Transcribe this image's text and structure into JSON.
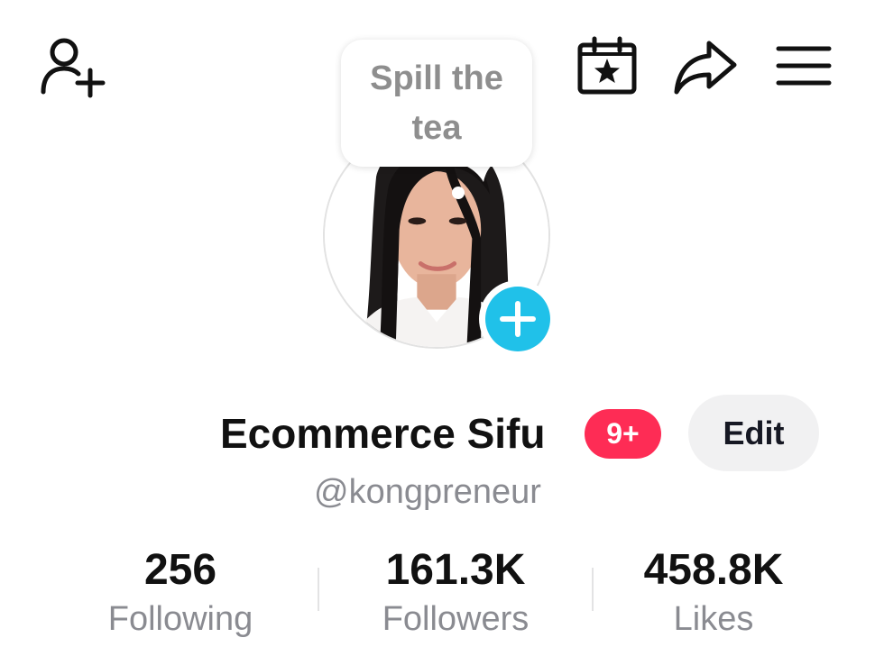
{
  "header": {
    "add_friend_icon": "person-plus-icon",
    "calendar_icon": "calendar-star-icon",
    "share_icon": "share-arrow-icon",
    "menu_icon": "hamburger-menu-icon"
  },
  "note_bubble": {
    "text": "Spill the tea"
  },
  "profile": {
    "display_name": "Ecommerce Sifu",
    "notification_badge": "9+",
    "edit_label": "Edit",
    "username": "@kongpreneur"
  },
  "stats": [
    {
      "value": "256",
      "label": "Following"
    },
    {
      "value": "161.3K",
      "label": "Followers"
    },
    {
      "value": "458.8K",
      "label": "Likes"
    }
  ],
  "colors": {
    "accent_add": "#20c1e9",
    "badge": "#fe2c55",
    "muted_text": "#8a8b91",
    "edit_button_bg": "#f1f1f2"
  }
}
